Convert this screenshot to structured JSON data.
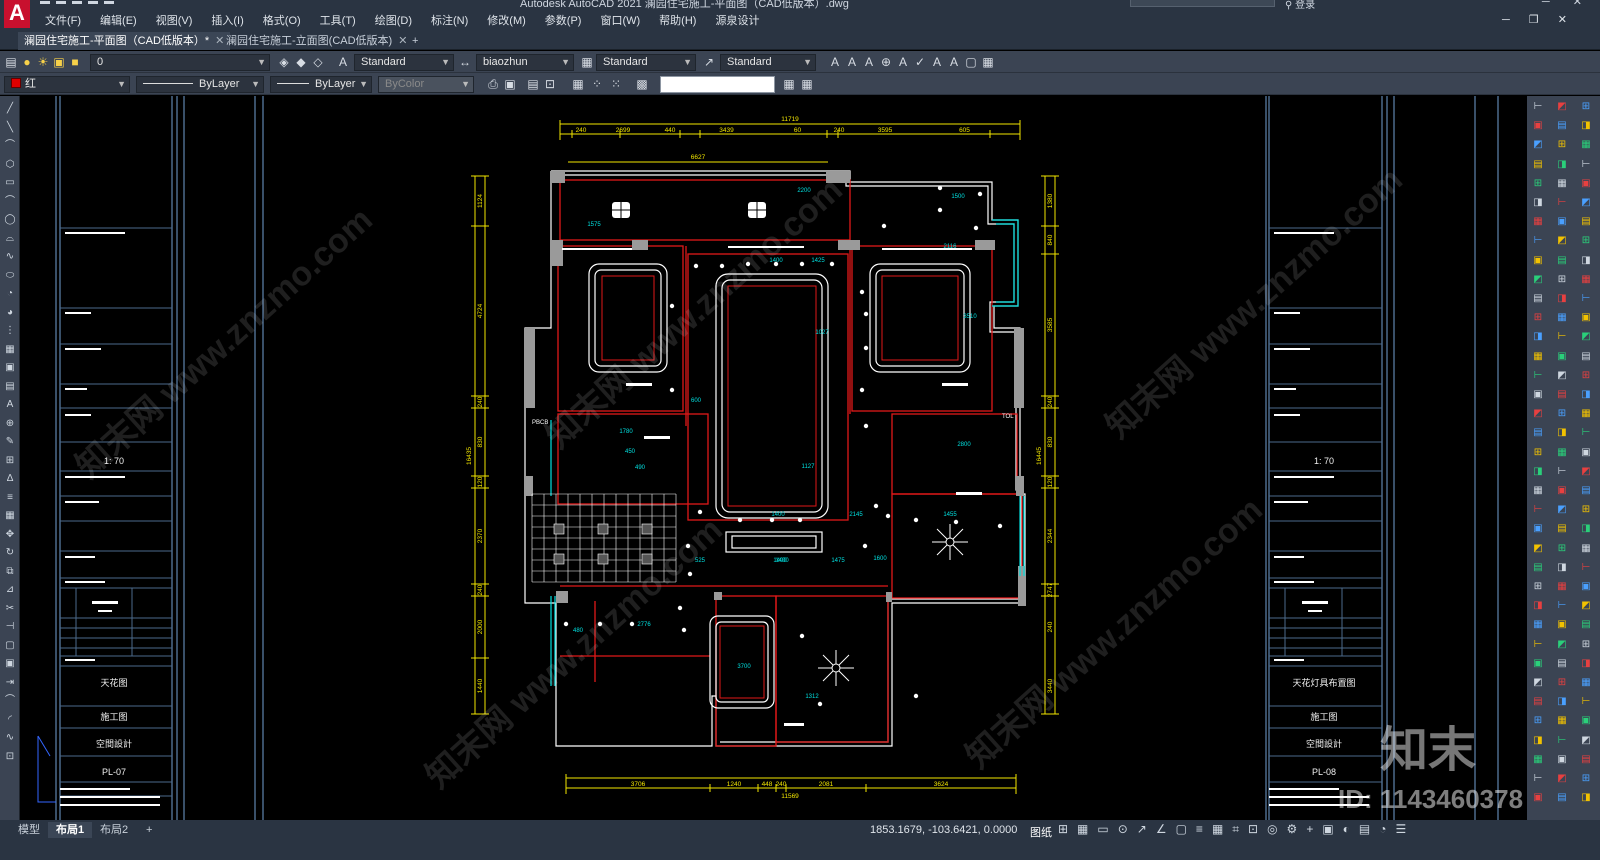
{
  "window": {
    "title": "Autodesk AutoCAD 2021    澜园住宅施工-平面图（CAD低版本）.dwg",
    "search_placeholder": "",
    "user_label": "登录"
  },
  "menu": {
    "items": [
      "文件(F)",
      "编辑(E)",
      "视图(V)",
      "插入(I)",
      "格式(O)",
      "工具(T)",
      "绘图(D)",
      "标注(N)",
      "修改(M)",
      "参数(P)",
      "窗口(W)",
      "帮助(H)",
      "源泉设计"
    ]
  },
  "tabs": [
    {
      "label": "澜园住宅施工-平面图（CAD低版本）*"
    },
    {
      "label": "澜园住宅施工-立面图(CAD低版本)"
    }
  ],
  "toolbar1": {
    "layer_value": "0",
    "text_style": "Standard",
    "dim_style": "biaozhun",
    "table_style": "Standard",
    "multileader_style": "Standard"
  },
  "toolbar2": {
    "color_value": "红",
    "linetype_value": "ByLayer",
    "lineweight_value": "ByLayer",
    "plotstyle_value": "ByColor"
  },
  "left_titleblock": {
    "scale": "1: 70",
    "drawing_name": "天花图",
    "stage": "施工图",
    "company": "空間設計",
    "sheet_no": "PL-07"
  },
  "right_titleblock": {
    "scale": "1: 70",
    "drawing_name": "天花灯具布置图",
    "stage": "施工图",
    "company": "空間設計",
    "sheet_no": "PL-08"
  },
  "dimensions": {
    "top_total": "11719",
    "top_segments": [
      "240",
      "2699",
      "440",
      "3439",
      "60",
      "240",
      "3595",
      "605"
    ],
    "top_inner": "6627",
    "bottom_total": "11569",
    "bottom_segments": [
      "3706",
      "1240",
      "448",
      "240",
      "2081",
      "3624"
    ],
    "left_total": "16435",
    "left_segments": [
      "1124",
      "4724",
      "240",
      "830",
      "120",
      "2370",
      "240",
      "2000",
      "1440"
    ],
    "right_total": "16445",
    "right_segments": [
      "1380",
      "840",
      "3585",
      "240",
      "830",
      "120",
      "2344",
      "2747",
      "240",
      "3440"
    ],
    "room_labels": [
      "2200",
      "1575",
      "1500",
      "2116",
      "1400",
      "1425",
      "1027",
      "1127",
      "1400",
      "2145",
      "1455",
      "1400",
      "1475",
      "1400",
      "525",
      "2776",
      "3700",
      "1312",
      "480",
      "1780",
      "450",
      "490",
      "600",
      "1600",
      "2800",
      "3510"
    ]
  },
  "tags": {
    "sub1": "PBCB",
    "sub2": "TOL"
  },
  "status": {
    "coordinates": "1853.1679, -103.6421, 0.0000",
    "mode_label": "图纸"
  },
  "layout_tabs": [
    "模型",
    "布局1",
    "布局2"
  ],
  "watermark": {
    "site": "www.znzmo.com",
    "brand": "知末网",
    "logo_text": "知末",
    "id_text": "ID: 1143460378"
  },
  "colors": {
    "ui_dark": "#2a3442",
    "toolbar": "#3b4453",
    "wall_red": "#e01818",
    "dim_yellow": "#f2e600",
    "frame_blue": "#4c6a8c",
    "cyan": "#00e0e0",
    "white": "#ffffff"
  }
}
